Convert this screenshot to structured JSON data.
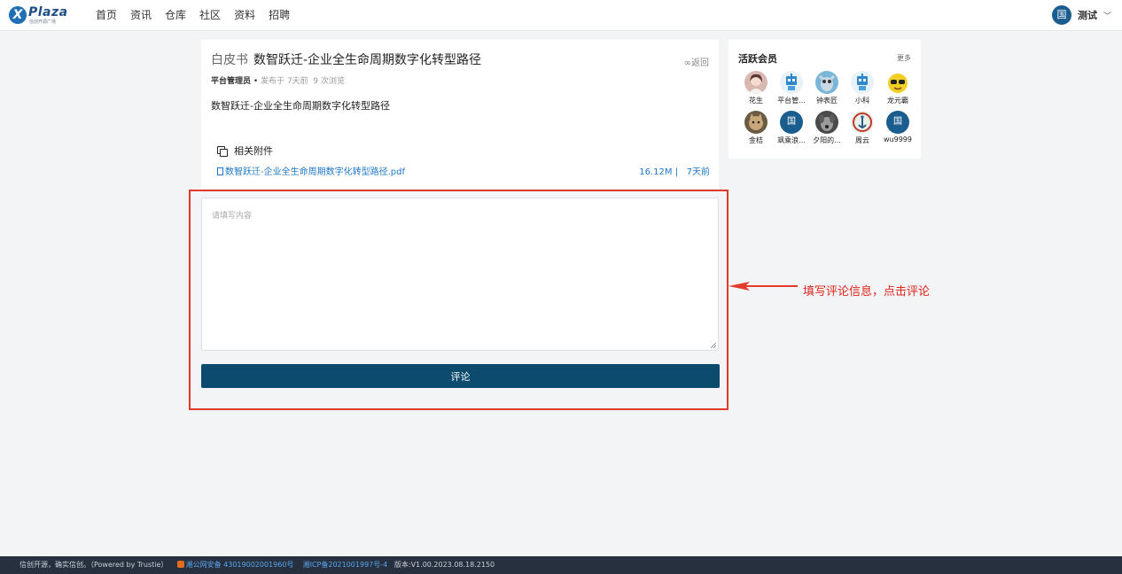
{
  "brand": {
    "logo_text": "Plaza",
    "logo_mark": "X",
    "logo_tagline": "信创开源广场"
  },
  "nav": {
    "items": [
      "首页",
      "资讯",
      "仓库",
      "社区",
      "资料",
      "招聘"
    ]
  },
  "user": {
    "avatar_char": "国",
    "name": "测试",
    "chevron": "﹀"
  },
  "article": {
    "category": "白皮书",
    "title": "数智跃迁-企业全生命周期数字化转型路径",
    "back_label": "∞返回",
    "author": "平台管理员",
    "separator": "•",
    "published": "发布于 7天前",
    "views": "9 次浏览",
    "body": "数智跃迁-企业全生命周期数字化转型路径"
  },
  "attachments": {
    "heading": "相关附件",
    "files": [
      {
        "name": "数智跃迁-企业全生命周期数字化转型路径.pdf",
        "size": "16.12M",
        "sep": "|",
        "time": "7天前"
      }
    ]
  },
  "comment": {
    "placeholder": "请填写内容",
    "submit_label": "评论"
  },
  "annotation": {
    "text": "填写评论信息，点击评论",
    "color": "#e0251b"
  },
  "sidebar": {
    "title": "活跃会员",
    "more": "更多",
    "members": [
      {
        "name": "花生",
        "avatar": "photo-girl",
        "color": "#d8b8b0"
      },
      {
        "name": "平台管...",
        "avatar": "robot-icon",
        "color": "#e8f2fa"
      },
      {
        "name": "钟表匠",
        "avatar": "cartoon",
        "color": "#7ab6d8"
      },
      {
        "name": "小科",
        "avatar": "robot-icon",
        "color": "#e8f2fa"
      },
      {
        "name": "龙元霸",
        "avatar": "emoji",
        "color": "#f2cf25"
      },
      {
        "name": "金桔",
        "avatar": "photo-cat",
        "color": "#6b5a44"
      },
      {
        "name": "飒乘浪...",
        "avatar_char": "国",
        "color": "#1b5d8f"
      },
      {
        "name": "夕阳的...",
        "avatar": "photo-dog",
        "color": "#4a4a4a"
      },
      {
        "name": "周云",
        "avatar": "anchor",
        "color": "#e8f0ea"
      },
      {
        "name": "wu9999",
        "avatar_char": "国",
        "color": "#1b5d8f"
      }
    ]
  },
  "footer": {
    "slogan": "信创开源，确实信创。（Powered by Trustie）",
    "police": "湘公网安备 43019002001960号",
    "icp": "湘ICP备2021001997号-4",
    "version": "版本:V1.00.2023.08.18.2150"
  },
  "colors": {
    "primary": "#0c4a6e",
    "link": "#1f78c8",
    "highlight": "#e23b2e",
    "footer_bg": "#26303f"
  }
}
